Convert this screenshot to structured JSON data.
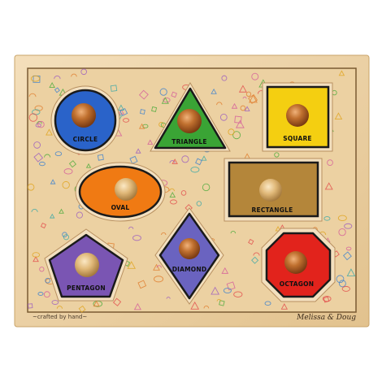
{
  "puzzle": {
    "pieces": [
      {
        "label": "CIRCLE",
        "shape": "circle",
        "color": "#2a63c9"
      },
      {
        "label": "TRIANGLE",
        "shape": "triangle",
        "color": "#3aa435"
      },
      {
        "label": "SQUARE",
        "shape": "square",
        "color": "#f4cf11"
      },
      {
        "label": "OVAL",
        "shape": "oval",
        "color": "#f07a13"
      },
      {
        "label": "RECTANGLE",
        "shape": "rectangle",
        "color": "#b4863a"
      },
      {
        "label": "PENTAGON",
        "shape": "pentagon",
        "color": "#7a55b3"
      },
      {
        "label": "DIAMOND",
        "shape": "diamond",
        "color": "#6a63c0"
      },
      {
        "label": "OCTAGON",
        "shape": "octagon",
        "color": "#e2231c"
      }
    ],
    "footer_left": "~crafted by hand~",
    "footer_right": "Melissa & Doug"
  },
  "colors": {
    "board": "#e8c996",
    "frame": "#efd7ad",
    "knob": "#a65a26"
  }
}
